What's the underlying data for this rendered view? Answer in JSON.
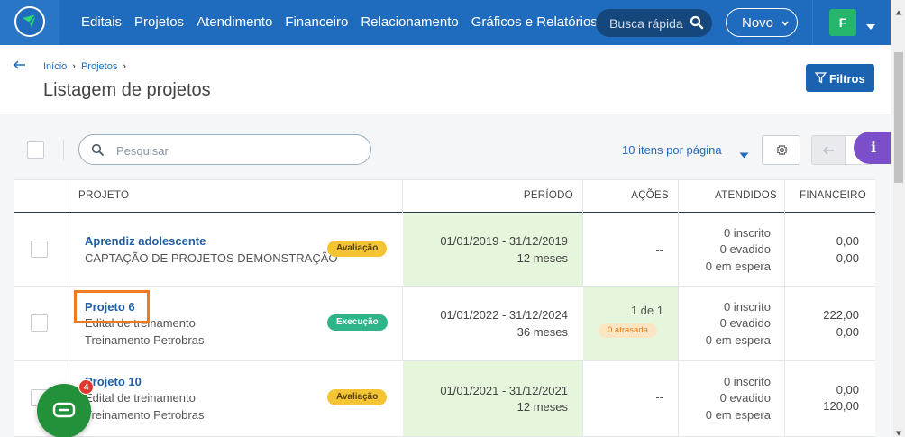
{
  "nav": {
    "items": [
      "Editais",
      "Projetos",
      "Atendimento",
      "Financeiro",
      "Relacionamento",
      "Gráficos e Relatórios"
    ],
    "search_placeholder": "Busca rápida",
    "new_label": "Novo",
    "avatar_letter": "F"
  },
  "header": {
    "breadcrumb": [
      "Início",
      "Projetos"
    ],
    "title": "Listagem de projetos",
    "filter_label": "Filtros"
  },
  "toolbar": {
    "search_placeholder": "Pesquisar",
    "per_page": "10 itens por página",
    "info_label": "i"
  },
  "table": {
    "columns": {
      "projeto": "PROJETO",
      "periodo": "PERÍODO",
      "acoes": "AÇÕES",
      "atendidos": "ATENDIDOS",
      "financeiro": "FINANCEIRO"
    },
    "rows": [
      {
        "title": "Aprendiz adolescente",
        "subtitle": "CAPTAÇÃO DE PROJETOS DEMONSTRAÇÃO",
        "badge": "Avaliação",
        "period": "01/01/2019 - 31/12/2019",
        "duration": "12 meses",
        "actions": "--",
        "enrolled": "0 inscrito",
        "dropped": "0 evadido",
        "waiting": "0 em espera",
        "fin1": "0,00",
        "fin2": "0,00"
      },
      {
        "title": "Projeto 6",
        "subtitle": "Edital de treinamento",
        "subtitle2": "Treinamento Petrobras",
        "badge": "Execução",
        "period": "01/01/2022 - 31/12/2024",
        "duration": "36 meses",
        "actions": "1 de 1",
        "late": "0 atrasada",
        "enrolled": "0 inscrito",
        "dropped": "0 evadido",
        "waiting": "0 em espera",
        "fin1": "222,00",
        "fin2": "0,00"
      },
      {
        "title": "Projeto 10",
        "subtitle": "Edital de treinamento",
        "subtitle2": "Treinamento Petrobras",
        "badge": "Avaliação",
        "period": "01/01/2021 - 31/12/2021",
        "duration": "12 meses",
        "actions": "--",
        "enrolled": "0 inscrito",
        "dropped": "0 evadido",
        "waiting": "0 em espera",
        "fin1": "0,00",
        "fin2": "120,00"
      }
    ]
  },
  "chat": {
    "count": "4"
  },
  "colors": {
    "nav_bg": "#1f6bbd",
    "primary_button": "#1b63b0",
    "badge_evaluation": "#f4c434",
    "badge_execution": "#2fb48a",
    "period_highlight": "#e6f6dc",
    "info_fab": "#7b4fc9",
    "chat_fab": "#239139",
    "annotation_box": "#f07a24"
  }
}
